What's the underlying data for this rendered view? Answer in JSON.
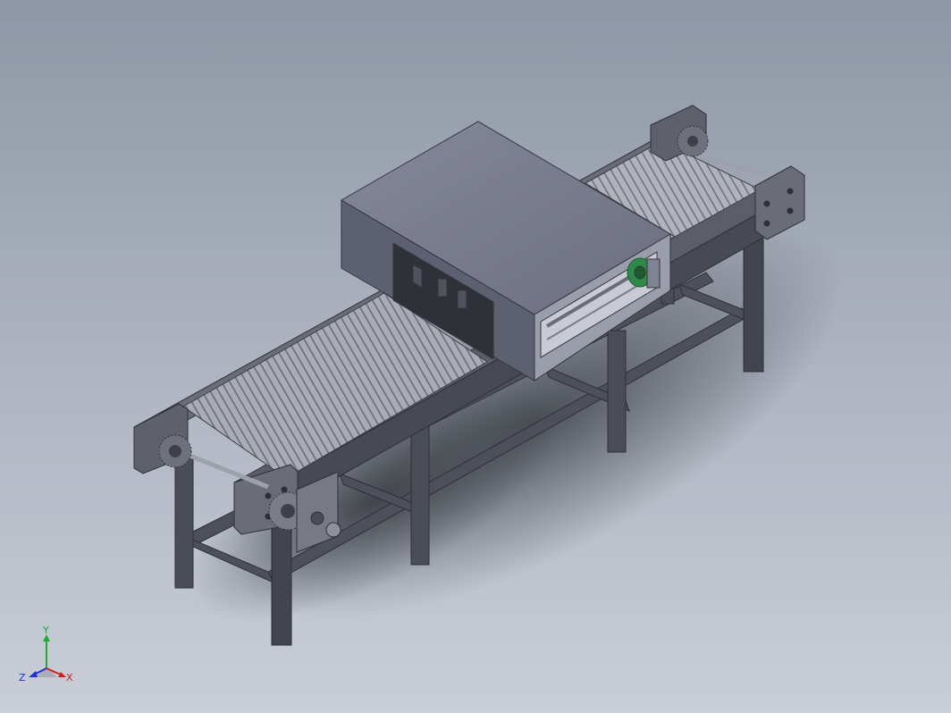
{
  "viewport": {
    "background_top": "#8e97a5",
    "background_bottom": "#c9ced7"
  },
  "model": {
    "colors": {
      "frame": "#5e616c",
      "frame_dark": "#3e4049",
      "frame_light": "#8a8d98",
      "housing_top": "#7d7f8e",
      "housing_front": "#5f6170",
      "housing_side": "#9598a6",
      "belt": "#a6a9b3",
      "belt_slat": "#6d707a",
      "motor_green": "#2f8a4a"
    }
  },
  "triad": {
    "x_label": "X",
    "y_label": "Y",
    "z_label": "Z",
    "x_color": "#cc2222",
    "y_color": "#22aa33",
    "z_color": "#2233cc"
  }
}
